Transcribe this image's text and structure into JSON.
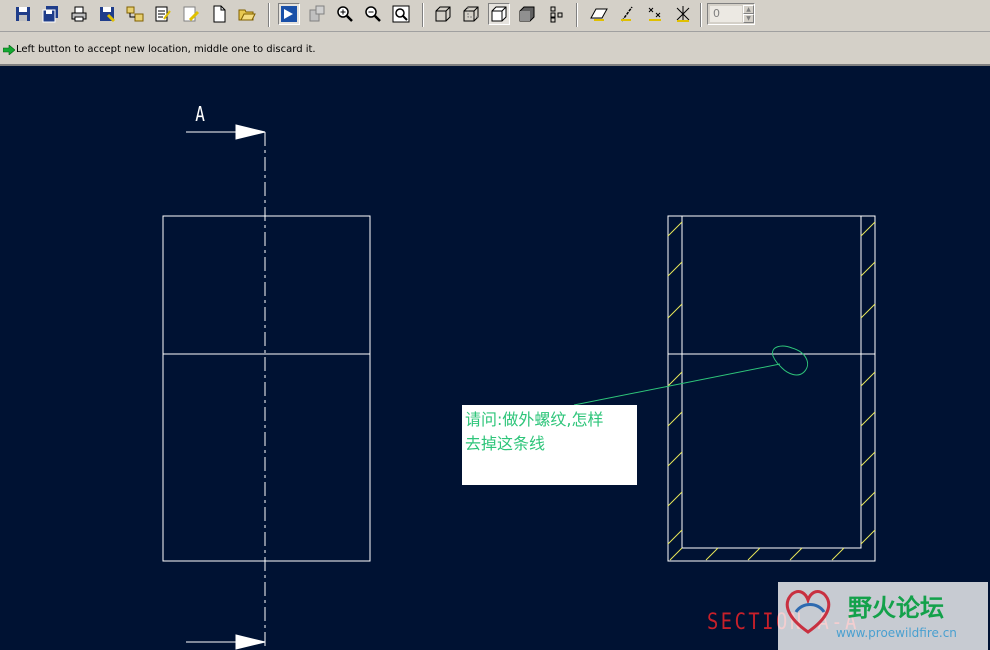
{
  "toolbar": {
    "buttons": [
      {
        "name": "save-icon"
      },
      {
        "name": "save-copy-icon"
      },
      {
        "name": "print-icon"
      },
      {
        "name": "save-as-icon"
      },
      {
        "name": "model-tree-icon"
      },
      {
        "name": "edit-script-icon"
      },
      {
        "name": "erase-icon"
      },
      {
        "name": "new-file-icon"
      },
      {
        "name": "open-folder-icon"
      },
      {
        "name": "repaint-icon"
      },
      {
        "name": "view-manager-icon"
      },
      {
        "name": "zoom-in-icon"
      },
      {
        "name": "zoom-out-icon"
      },
      {
        "name": "refit-icon"
      },
      {
        "name": "wireframe-icon"
      },
      {
        "name": "hidden-line-icon"
      },
      {
        "name": "no-hidden-icon"
      },
      {
        "name": "shaded-icon"
      },
      {
        "name": "datum-display-icon"
      },
      {
        "name": "datum-plane-icon"
      },
      {
        "name": "datum-axis-icon"
      },
      {
        "name": "datum-point-icon"
      },
      {
        "name": "coordinate-system-icon"
      }
    ],
    "spinner_value": "0"
  },
  "message": {
    "icon": "green-arrow-icon",
    "text": "Left button to accept new location, middle one to discard it."
  },
  "drawing": {
    "view_label": "A",
    "note_lines": [
      "请问:做外螺纹,怎样",
      "去掉这条线"
    ],
    "section_label": "SECTION  A-A",
    "colors": {
      "background": "#001233",
      "geometry": "#ffffff",
      "hatch": "#e8e85a",
      "leader": "#2ec57a",
      "section_text": "#c8202a"
    }
  },
  "watermark": {
    "title": "野火论坛",
    "url": "www.proewildfire.cn"
  }
}
